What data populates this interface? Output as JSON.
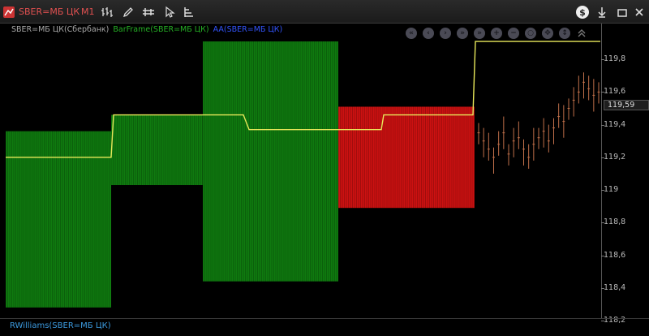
{
  "toolbar": {
    "instrument": "SBER=МБ ЦК",
    "timeframe": "M1",
    "icons": [
      "chart-type-icon",
      "pencil-icon",
      "bars-settings-icon",
      "cursor-icon",
      "indicators-icon"
    ],
    "right_icons": [
      "dollar-icon",
      "download-icon",
      "minimize-icon",
      "close-icon"
    ]
  },
  "legend": {
    "instrument_label": "SBER=МБ ЦК(Сбербанк)",
    "barframe_label": "BarFrame(SBER=МБ ЦК)",
    "aa_label": "AA(SBER=МБ ЦК)"
  },
  "nav_buttons": [
    "first-icon",
    "prev-icon",
    "play-icon",
    "next-icon",
    "last-icon",
    "zoom-in-icon",
    "zoom-out-icon",
    "zoom-fit-icon",
    "pan-icon",
    "scale-icon",
    "collapse-icon"
  ],
  "price_label": "119,59",
  "lower_panel": {
    "label": "RWilliams(SBER=МБ ЦК)"
  },
  "colors": {
    "green": "#0f7a0f",
    "red": "#cc1111",
    "yellow": "#e8e85a",
    "candle": "#c0704a"
  },
  "chart_data": {
    "type": "bar",
    "ylim": [
      118.15,
      119.95
    ],
    "yticks": [
      "119,8",
      "119,6",
      "119,4",
      "119,2",
      "119",
      "118,8",
      "118,6",
      "118,4",
      "118,2"
    ],
    "yticks_values": [
      119.8,
      119.6,
      119.4,
      119.2,
      119.0,
      118.8,
      118.6,
      118.4,
      118.2
    ],
    "frames": [
      {
        "color": "green",
        "low": 118.28,
        "high": 119.36
      },
      {
        "color": "green",
        "low": 119.03,
        "high": 119.46
      },
      {
        "color": "green",
        "low": 118.44,
        "high": 119.91
      },
      {
        "color": "red",
        "low": 118.89,
        "high": 119.51
      }
    ],
    "aa_line": [
      119.2,
      119.46,
      119.46,
      119.37,
      119.37,
      119.46,
      119.46,
      119.91,
      119.91
    ],
    "candles": [
      119.35,
      119.3,
      119.25,
      119.2,
      119.28,
      119.35,
      119.22,
      119.3,
      119.32,
      119.25,
      119.2,
      119.28,
      119.32,
      119.36,
      119.3,
      119.38,
      119.45,
      119.42,
      119.5,
      119.55,
      119.6,
      119.66,
      119.62,
      119.58,
      119.6
    ]
  }
}
